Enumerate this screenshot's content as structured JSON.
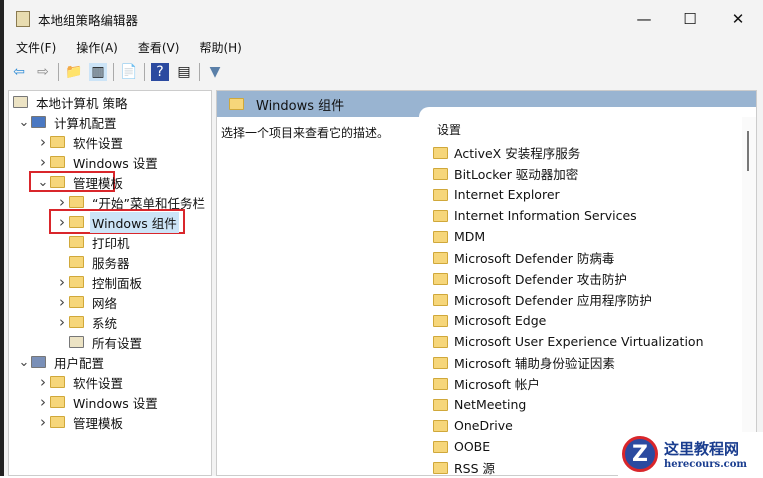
{
  "window": {
    "title": "本地组策略编辑器",
    "minimize": "—",
    "maximize": "☐",
    "close": "✕"
  },
  "menu": [
    "文件(F)",
    "操作(A)",
    "查看(V)",
    "帮助(H)"
  ],
  "toolbar": [
    {
      "icon": "back-icon",
      "g": "⇦"
    },
    {
      "icon": "forward-icon",
      "g": "⇨"
    },
    {
      "icon": "up-folder-icon",
      "g": "📁"
    },
    {
      "icon": "show-hide-tree-icon",
      "g": "▥"
    },
    {
      "icon": "export-icon",
      "g": "📄"
    },
    {
      "icon": "help-icon",
      "g": "?"
    },
    {
      "icon": "properties-icon",
      "g": "▤"
    },
    {
      "icon": "filter-icon",
      "g": "▼"
    }
  ],
  "tree": [
    {
      "label": "本地计算机 策略",
      "level": 0,
      "chev": "",
      "icon": "policy"
    },
    {
      "label": "计算机配置",
      "level": 1,
      "chev": "v",
      "icon": "computer"
    },
    {
      "label": "软件设置",
      "level": 2,
      "chev": ">",
      "icon": "folder"
    },
    {
      "label": "Windows 设置",
      "level": 2,
      "chev": ">",
      "icon": "folder"
    },
    {
      "label": "管理模板",
      "level": 2,
      "chev": "v",
      "icon": "folder"
    },
    {
      "label": "“开始”菜单和任务栏",
      "level": 3,
      "chev": ">",
      "icon": "folder"
    },
    {
      "label": "Windows 组件",
      "level": 3,
      "chev": ">",
      "icon": "folder",
      "selected": true
    },
    {
      "label": "打印机",
      "level": 3,
      "chev": "",
      "icon": "folder"
    },
    {
      "label": "服务器",
      "level": 3,
      "chev": "",
      "icon": "folder"
    },
    {
      "label": "控制面板",
      "level": 3,
      "chev": ">",
      "icon": "folder"
    },
    {
      "label": "网络",
      "level": 3,
      "chev": ">",
      "icon": "folder"
    },
    {
      "label": "系统",
      "level": 3,
      "chev": ">",
      "icon": "folder"
    },
    {
      "label": "所有设置",
      "level": 3,
      "chev": "",
      "icon": "settings"
    },
    {
      "label": "用户配置",
      "level": 1,
      "chev": "v",
      "icon": "user"
    },
    {
      "label": "软件设置",
      "level": 2,
      "chev": ">",
      "icon": "folder"
    },
    {
      "label": "Windows 设置",
      "level": 2,
      "chev": ">",
      "icon": "folder"
    },
    {
      "label": "管理模板",
      "level": 2,
      "chev": ">",
      "icon": "folder"
    }
  ],
  "right": {
    "header": "Windows 组件",
    "description": "选择一个项目来查看它的描述。",
    "column": "设置",
    "items": [
      "ActiveX 安装程序服务",
      "BitLocker 驱动器加密",
      "Internet Explorer",
      "Internet Information Services",
      "MDM",
      "Microsoft Defender 防病毒",
      "Microsoft Defender 攻击防护",
      "Microsoft Defender 应用程序防护",
      "Microsoft Edge",
      "Microsoft User Experience Virtualization",
      "Microsoft 辅助身份验证因素",
      "Microsoft 帐户",
      "NetMeeting",
      "OneDrive",
      "OOBE",
      "RSS 源"
    ]
  },
  "watermark": {
    "name": "这里教程网",
    "url": "herecours.com"
  }
}
